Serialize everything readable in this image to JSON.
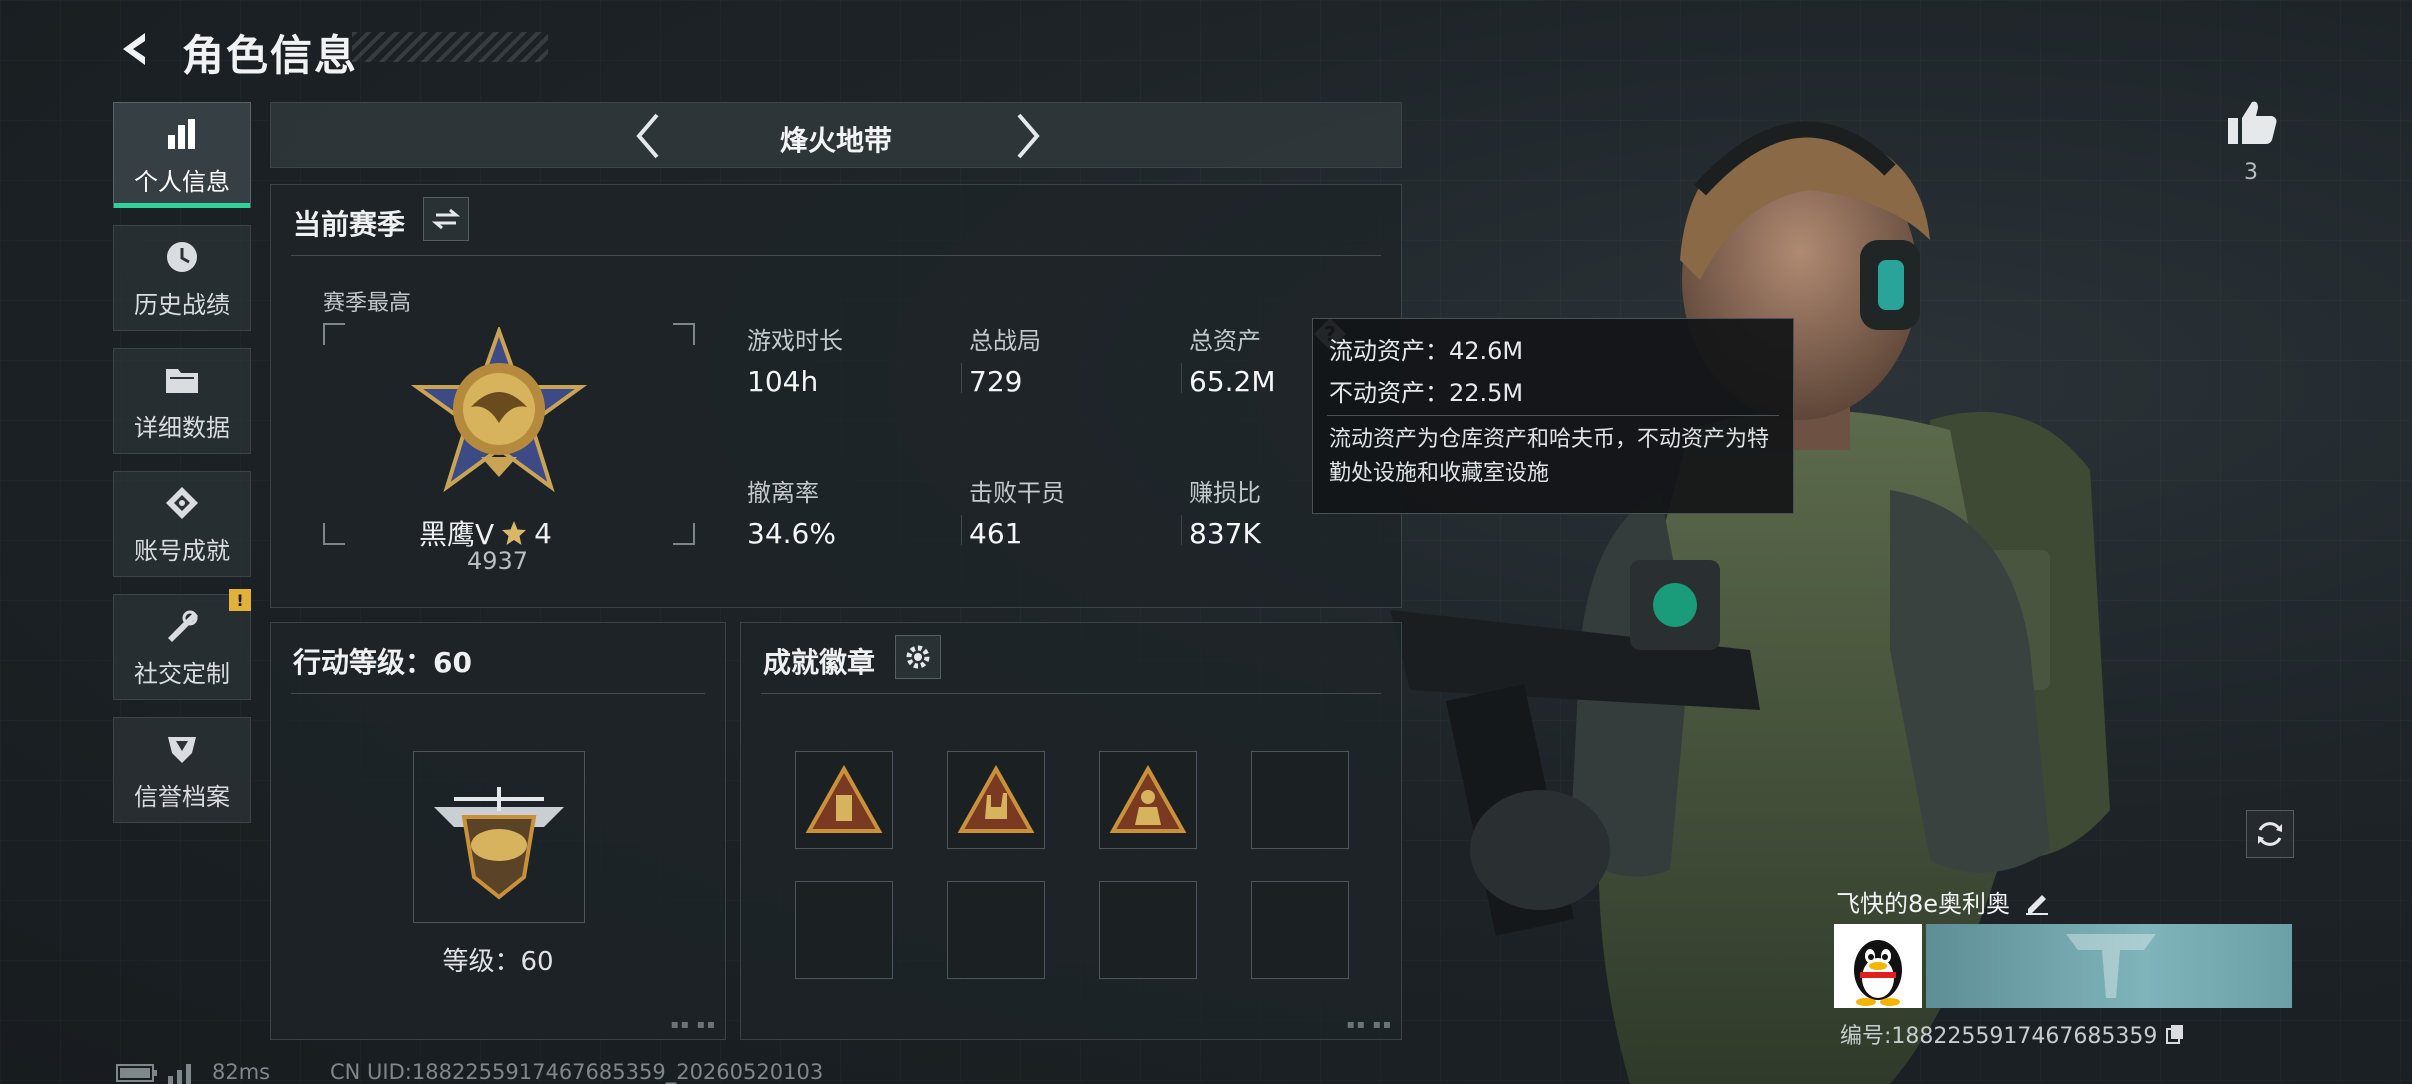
{
  "header": {
    "title": "角色信息"
  },
  "sidebar": {
    "items": [
      {
        "label": "个人信息",
        "icon": "bar-chart-icon",
        "active": true
      },
      {
        "label": "历史战绩",
        "icon": "history-clock-icon",
        "active": false
      },
      {
        "label": "详细数据",
        "icon": "folder-icon",
        "active": false
      },
      {
        "label": "账号成就",
        "icon": "achievement-diamond-icon",
        "active": false
      },
      {
        "label": "社交定制",
        "icon": "tools-icon",
        "active": false,
        "badge": "!"
      },
      {
        "label": "信誉档案",
        "icon": "reputation-shield-icon",
        "active": false
      }
    ]
  },
  "mode": {
    "label": "烽火地带"
  },
  "season": {
    "title": "当前赛季",
    "best_label": "赛季最高",
    "rank_name": "黑鹰V",
    "rank_stars": "4",
    "rank_score": "4937",
    "stats": [
      {
        "label": "游戏时长",
        "value": "104h"
      },
      {
        "label": "总战局",
        "value": "729"
      },
      {
        "label": "总资产",
        "value": "65.2M"
      },
      {
        "label": "撤离率",
        "value": "34.6%"
      },
      {
        "label": "击败干员",
        "value": "461"
      },
      {
        "label": "赚损比",
        "value": "837K"
      }
    ]
  },
  "tooltip": {
    "liquid": "流动资产：42.6M",
    "fixed": "不动资产：22.5M",
    "description": "流动资产为仓库资产和哈夫币，不动资产为特勤处设施和收藏室设施"
  },
  "action_level": {
    "title": "行动等级：60",
    "level_text": "等级：60"
  },
  "badges": {
    "title": "成就徽章",
    "slots": [
      "badge-triangle-icon",
      "badge-rock-hand-icon",
      "badge-soldier-icon",
      "",
      "",
      "",
      "",
      ""
    ]
  },
  "likes": {
    "count": "3"
  },
  "player": {
    "name": "飞快的8e奥利奥",
    "id_text": "编号:1882255917467685359"
  },
  "footer": {
    "ping": "82ms",
    "uid": "CN UID:1882255917467685359_20260520103"
  },
  "colors": {
    "accent": "#2fd39a",
    "badge_gold": "#c9913a",
    "warning": "#e0b23a"
  }
}
